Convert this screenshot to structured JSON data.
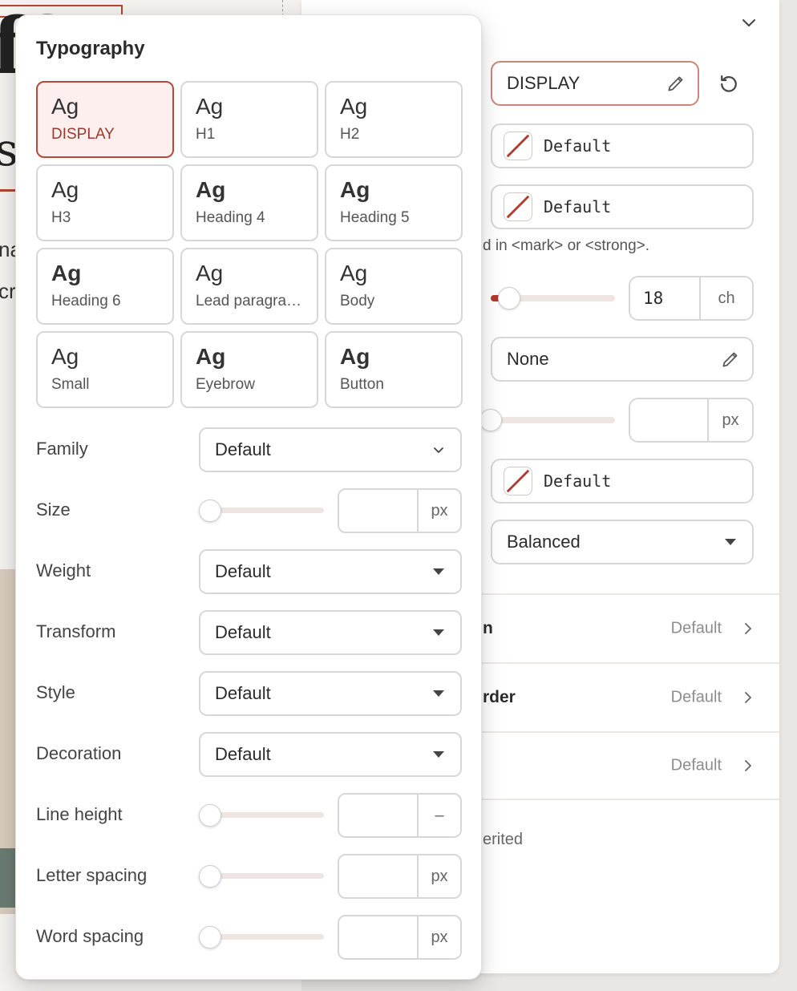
{
  "canvas": {
    "line1": "na",
    "line2": "cr"
  },
  "panel": {
    "text_style_value": "DISPLAY",
    "color1_label": "Default",
    "color2_label": "Default",
    "hint": "d in <mark> or <strong>.",
    "measure_value": "18",
    "measure_unit": "ch",
    "measure_level_fraction": 0.15,
    "shadow_value": "None",
    "size_unit": "px",
    "size_level_fraction": 0,
    "color3_label": "Default",
    "wrap_value": "Balanced",
    "sections": [
      {
        "label": "n",
        "value": "Default"
      },
      {
        "label": "rder",
        "value": "Default"
      },
      {
        "label": "",
        "value": "Default"
      }
    ],
    "inherited": "erited"
  },
  "typography": {
    "title": "Typography",
    "presets": [
      {
        "sample": "Ag",
        "name": "DISPLAY",
        "active": true
      },
      {
        "sample": "Ag",
        "name": "H1"
      },
      {
        "sample": "Ag",
        "name": "H2"
      },
      {
        "sample": "Ag",
        "name": "H3"
      },
      {
        "sample": "Ag",
        "name": "Heading 4"
      },
      {
        "sample": "Ag",
        "name": "Heading 5"
      },
      {
        "sample": "Ag",
        "name": "Heading 6"
      },
      {
        "sample": "Ag",
        "name": "Lead paragra…"
      },
      {
        "sample": "Ag",
        "name": "Body"
      },
      {
        "sample": "Ag",
        "name": "Small"
      },
      {
        "sample": "Ag",
        "name": "Eyebrow"
      },
      {
        "sample": "Ag",
        "name": "Button"
      }
    ],
    "family": {
      "label": "Family",
      "value": "Default"
    },
    "size": {
      "label": "Size",
      "value": "",
      "unit": "px"
    },
    "weight": {
      "label": "Weight",
      "value": "Default"
    },
    "transform": {
      "label": "Transform",
      "value": "Default"
    },
    "style": {
      "label": "Style",
      "value": "Default"
    },
    "decoration": {
      "label": "Decoration",
      "value": "Default"
    },
    "line_height": {
      "label": "Line height",
      "value": "",
      "unit": "–"
    },
    "letter_spacing": {
      "label": "Letter spacing",
      "value": "",
      "unit": "px"
    },
    "word_spacing": {
      "label": "Word spacing",
      "value": "",
      "unit": "px"
    }
  },
  "colors": {
    "accent": "#b03a2e",
    "active_bg": "#fdefed",
    "border": "#d9d7d5"
  },
  "icons": {
    "chevron_top": "chevron-down-icon",
    "pencil": "pencil-icon",
    "reset": "reset-icon",
    "caret": "caret-down-icon",
    "arrow": "chevron-right-icon"
  }
}
